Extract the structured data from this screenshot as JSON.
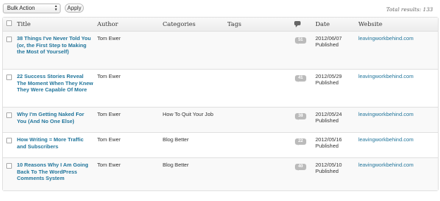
{
  "toolbar": {
    "bulk_action": "Bulk Action",
    "apply_label": "Apply",
    "total_results": "Total results: 133"
  },
  "columns": {
    "title": "Title",
    "author": "Author",
    "categories": "Categories",
    "tags": "Tags",
    "comments_icon": "comment-bubble-icon",
    "date": "Date",
    "website": "Website"
  },
  "rows": [
    {
      "title": "38 Things I've Never Told You (or, the First Step to Making the Most of Yourself)",
      "author": "Tom Ewer",
      "categories": "",
      "tags": "",
      "comments": "51",
      "date": "2012/06/07",
      "status": "Published",
      "website": "leavingworkbehind.com"
    },
    {
      "title": "22 Success Stories Reveal The Moment When They Knew They Were Capable Of More",
      "author": "Tom Ewer",
      "categories": "",
      "tags": "",
      "comments": "41",
      "date": "2012/05/29",
      "status": "Published",
      "website": "leavingworkbehind.com"
    },
    {
      "title": "Why I'm Getting Naked For You (And No One Else)",
      "author": "Tom Ewer",
      "categories": "How To Quit Your Job",
      "tags": "",
      "comments": "38",
      "date": "2012/05/24",
      "status": "Published",
      "website": "leavingworkbehind.com"
    },
    {
      "title": "How Writing = More Traffic and Subscribers",
      "author": "Tom Ewer",
      "categories": "Blog Better",
      "tags": "",
      "comments": "22",
      "date": "2012/05/16",
      "status": "Published",
      "website": "leavingworkbehind.com"
    },
    {
      "title": "10 Reasons Why I Am Going Back To The WordPress Comments System",
      "author": "Tom Ewer",
      "categories": "Blog Better",
      "tags": "",
      "comments": "40",
      "date": "2012/05/10",
      "status": "Published",
      "website": "leavingworkbehind.com"
    }
  ],
  "colors": {
    "link": "#21759b",
    "bubble": "#bbbbbb",
    "border": "#dfdfdf"
  }
}
